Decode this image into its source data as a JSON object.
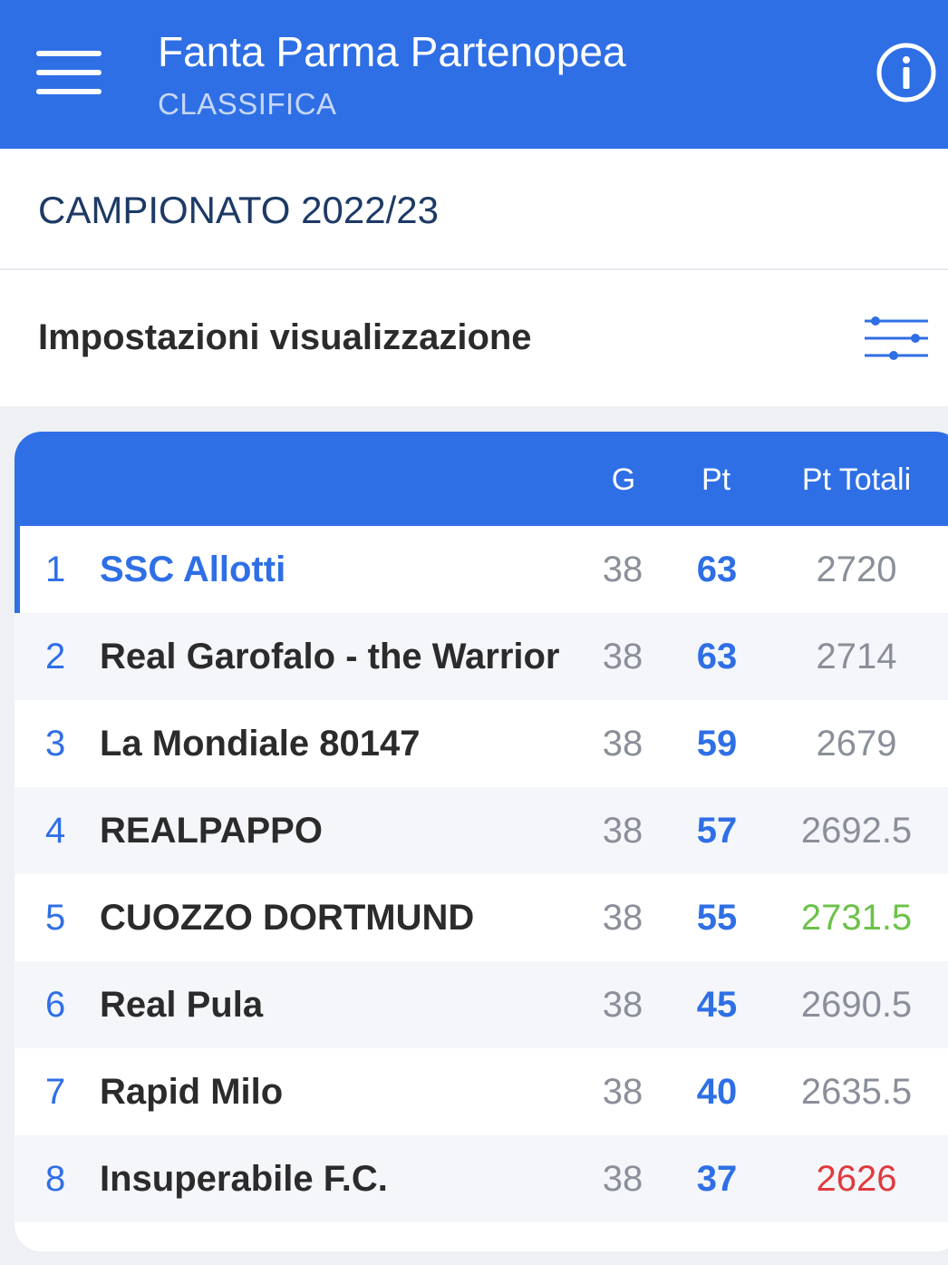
{
  "header": {
    "title": "Fanta Parma Partenopea",
    "subtitle": "CLASSIFICA",
    "menu_icon": "hamburger-menu-icon",
    "info_icon": "info-icon",
    "background_color": "#2f6fe6"
  },
  "season": {
    "label": "CAMPIONATO 2022/23"
  },
  "settings": {
    "label": "Impostazioni visualizzazione",
    "icon": "sliders-icon"
  },
  "standings": {
    "columns": {
      "games": "G",
      "points": "Pt",
      "total_points": "Pt Totali"
    },
    "rows": [
      {
        "rank": "1",
        "team": "SSC Allotti",
        "games": "38",
        "points": "63",
        "total": "2720"
      },
      {
        "rank": "2",
        "team": "Real Garofalo - the Warrior",
        "games": "38",
        "points": "63",
        "total": "2714"
      },
      {
        "rank": "3",
        "team": "La Mondiale 80147",
        "games": "38",
        "points": "59",
        "total": "2679"
      },
      {
        "rank": "4",
        "team": "REALPAPPO",
        "games": "38",
        "points": "57",
        "total": "2692.5"
      },
      {
        "rank": "5",
        "team": "CUOZZO DORTMUND",
        "games": "38",
        "points": "55",
        "total": "2731.5"
      },
      {
        "rank": "6",
        "team": "Real Pula",
        "games": "38",
        "points": "45",
        "total": "2690.5"
      },
      {
        "rank": "7",
        "team": "Rapid Milo",
        "games": "38",
        "points": "40",
        "total": "2635.5"
      },
      {
        "rank": "8",
        "team": "Insuperabile F.C.",
        "games": "38",
        "points": "37",
        "total": "2626"
      }
    ],
    "colors": {
      "accent": "#2f6fe6",
      "best_total": "#6cc24a",
      "worst_total": "#e0393e"
    }
  }
}
